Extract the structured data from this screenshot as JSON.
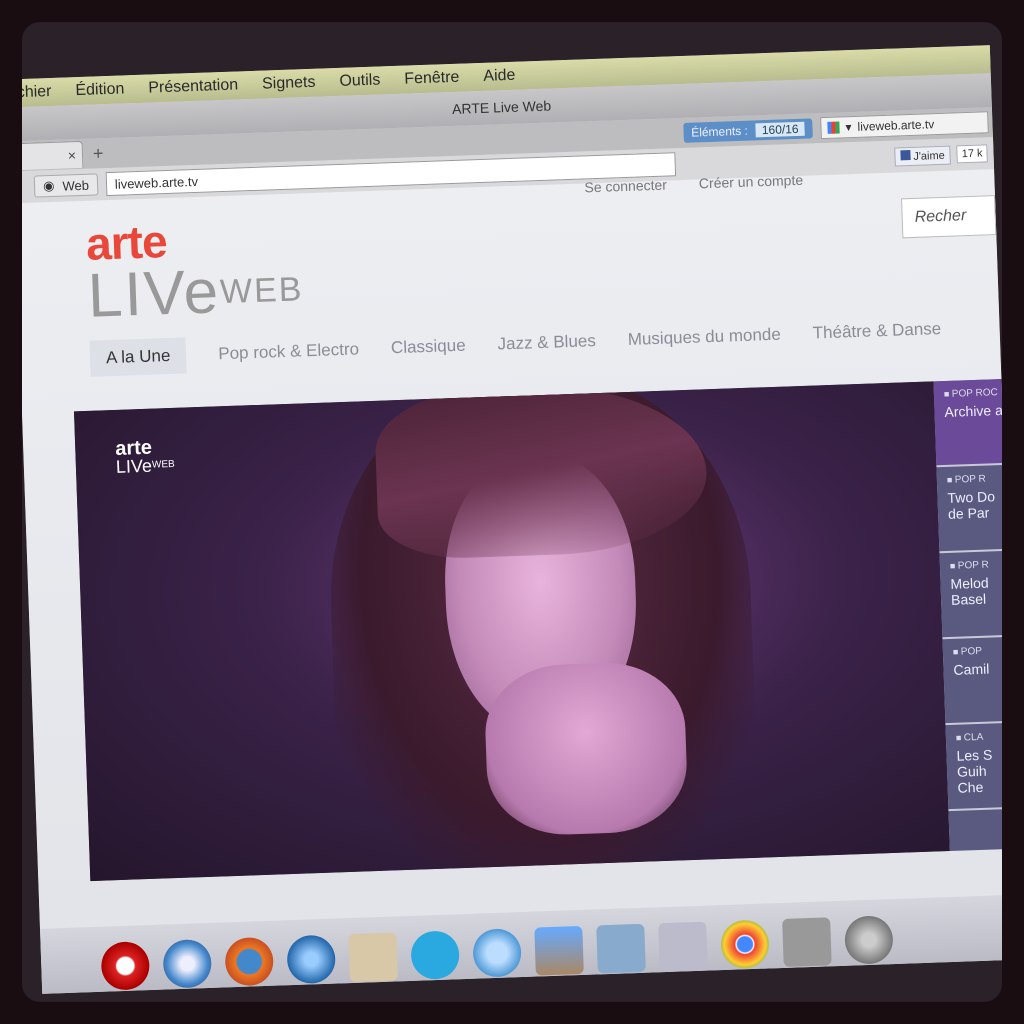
{
  "menubar": {
    "items": [
      "chier",
      "Édition",
      "Présentation",
      "Signets",
      "Outils",
      "Fenêtre",
      "Aide"
    ]
  },
  "window": {
    "title": "ARTE Live Web"
  },
  "tabs": {
    "close": "×",
    "new_tab": "+"
  },
  "toolbar": {
    "elements_label": "Éléments :",
    "elements_count": "160/16",
    "search_value": "liveweb.arte.tv"
  },
  "address": {
    "web_label": "Web",
    "url": "liveweb.arte.tv"
  },
  "facebook": {
    "like": "J'aime",
    "count": "17 k"
  },
  "account": {
    "login": "Se connecter",
    "signup": "Créer un compte"
  },
  "search": {
    "placeholder": "Recher"
  },
  "logo": {
    "arte": "arte",
    "live": "LIVe",
    "web": "WEB"
  },
  "nav": {
    "items": [
      "A la Une",
      "Pop rock & Electro",
      "Classique",
      "Jazz & Blues",
      "Musiques du monde",
      "Théâtre & Danse"
    ]
  },
  "player": {
    "logo_arte": "arte",
    "logo_live": "LIVe",
    "logo_web": "WEB"
  },
  "playlist": {
    "items": [
      {
        "category": "POP ROC",
        "title": "Archive a"
      },
      {
        "category": "POP R",
        "title": "Two Do\nde Par"
      },
      {
        "category": "POP R",
        "title": "Melod\nBasel"
      },
      {
        "category": "POP",
        "title": "Camil"
      },
      {
        "category": "CLA",
        "title": "Les S\nGuih\nChe"
      }
    ]
  },
  "colors": {
    "brand": "#e8473a",
    "playlist_bg": "#5a5a80",
    "playlist_active": "#6b4a9a"
  }
}
